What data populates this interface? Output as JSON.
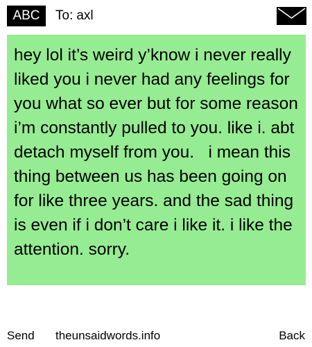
{
  "header": {
    "input_mode": "ABC",
    "to_label": "To:",
    "recipient": "axl",
    "envelope_icon": "envelope-icon"
  },
  "message": {
    "text": "hey lol it’s weird y’know i never really liked you i never had any feelings for you what so ever but for some reason i’m constantly pulled to you. like i. abt detach myself from you.   i mean this thing between us has been going on for like three years. and the sad thing is even if i don’t care i like it. i like the attention. sorry.",
    "background_color": "#96ec92"
  },
  "footer": {
    "send_label": "Send",
    "site_label": "theunsaidwords.info",
    "back_label": "Back"
  }
}
